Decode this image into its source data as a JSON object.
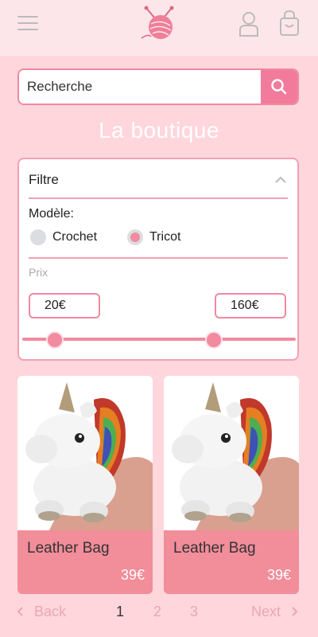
{
  "header": {
    "menu_icon": "hamburger-menu-icon",
    "logo_icon": "yarn-ball-logo",
    "user_icon": "user-icon",
    "cart_icon": "shopping-bag-icon"
  },
  "search": {
    "placeholder": "Recherche",
    "icon": "search-icon"
  },
  "page_title": "La boutique",
  "filter": {
    "title": "Filtre",
    "model_label": "Modèle:",
    "options": [
      {
        "label": "Crochet",
        "selected": false
      },
      {
        "label": "Tricot",
        "selected": true
      }
    ],
    "price_label": "Prix",
    "min_price": "20€",
    "max_price": "160€",
    "range_min_fraction": 0.12,
    "range_max_fraction": 0.7
  },
  "products": [
    {
      "name": "Leather Bag",
      "price": "39€",
      "image": "crochet-unicorn-photo"
    },
    {
      "name": "Leather Bag",
      "price": "39€",
      "image": "crochet-unicorn-photo"
    }
  ],
  "pagination": {
    "back_label": "Back",
    "next_label": "Next",
    "pages": [
      "1",
      "2",
      "3"
    ],
    "current": "1"
  },
  "colors": {
    "background": "#ffd6dc",
    "accent": "#f27b9b",
    "card_footer": "#f28d9a"
  }
}
